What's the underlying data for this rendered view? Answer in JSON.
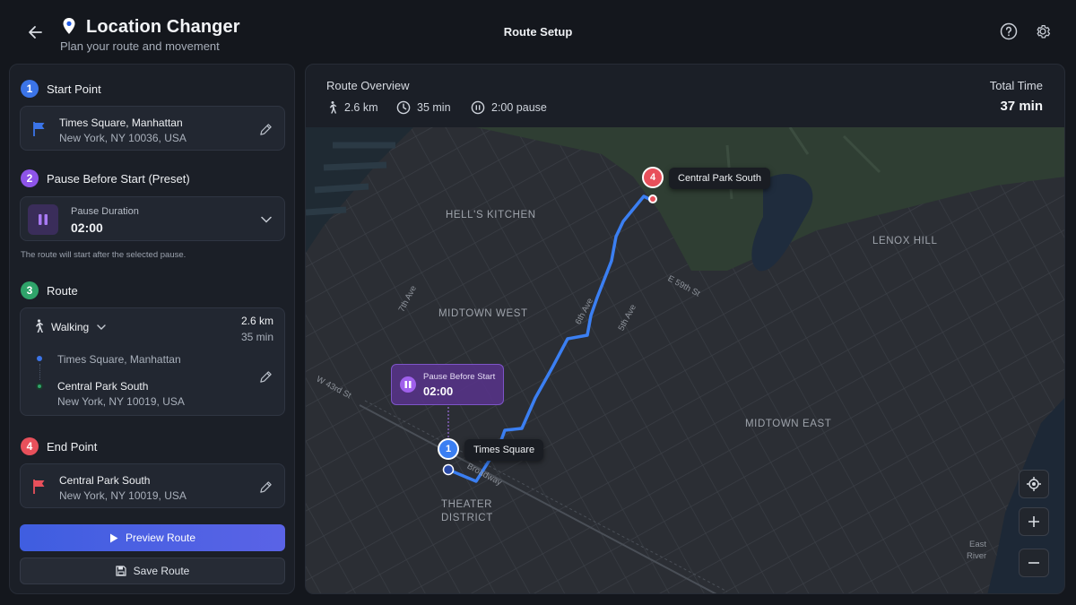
{
  "header": {
    "title": "Location Changer",
    "subtitle": "Plan your route and movement",
    "center_title": "Route Setup",
    "icons": [
      "back-arrow-icon",
      "map-pin-icon",
      "help-icon",
      "gear-icon"
    ]
  },
  "steps": {
    "start": {
      "number": "1",
      "label": "Start Point",
      "place": "Times Square, Manhattan",
      "address": "New York, NY 10036, USA",
      "color": "#3b74e8"
    },
    "pause": {
      "number": "2",
      "label": "Pause Before Start (Preset)",
      "duration_label": "Pause Duration",
      "duration_value": "02:00",
      "note": "The route will start after the selected pause.",
      "color": "#8e54e9"
    },
    "route": {
      "number": "3",
      "label": "Route",
      "mode": "Walking",
      "distance": "2.6 km",
      "time": "35 min",
      "from": "Times Square, Manhattan",
      "to_place": "Central Park South",
      "to_address": "New York, NY 10019, USA",
      "color": "#2fa46a"
    },
    "end": {
      "number": "4",
      "label": "End Point",
      "place": "Central Park South",
      "address": "New York, NY 10019, USA",
      "color": "#e8505b"
    }
  },
  "buttons": {
    "preview": "Preview Route",
    "save": "Save Route"
  },
  "overview": {
    "title": "Route Overview",
    "distance": "2.6 km",
    "duration": "35 min",
    "pause": "2:00 pause",
    "total_label": "Total Time",
    "total_value": "37 min"
  },
  "map": {
    "neighborhoods": [
      "HELL'S KITCHEN",
      "MIDTOWN WEST",
      "LENOX HILL",
      "MIDTOWN EAST",
      "THEATER",
      "DISTRICT"
    ],
    "streets": [
      "7th Ave",
      "5th Ave",
      "E 59th St",
      "W 43rd St",
      "6th Ave",
      "Broadway",
      "East",
      "River"
    ],
    "start_marker": {
      "number": "1",
      "label": "Times Square"
    },
    "end_marker": {
      "number": "4",
      "label": "Central Park South"
    },
    "pause_card": {
      "title": "Pause Before Start",
      "value": "02:00"
    },
    "route_color": "#3b7ff2",
    "controls": [
      "locate-icon",
      "zoom-in-icon",
      "zoom-out-icon"
    ]
  }
}
